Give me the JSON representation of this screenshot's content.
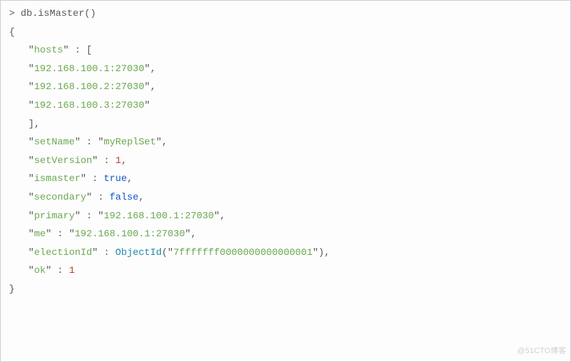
{
  "prompt_symbol": ">",
  "command": "db.isMaster()",
  "result": {
    "hosts": [
      "192.168.100.1:27030",
      "192.168.100.2:27030",
      "192.168.100.3:27030"
    ],
    "setName": "myReplSet",
    "setVersion": 1,
    "ismaster": true,
    "secondary": false,
    "primary": "192.168.100.1:27030",
    "me": "192.168.100.1:27030",
    "electionId_func": "ObjectId",
    "electionId_arg": "7fffffff0000000000000001",
    "ok": 1
  },
  "punct": {
    "open_brace": "{",
    "close_brace": "}",
    "open_bracket": "[",
    "close_bracket": "],",
    "colon_space": " : ",
    "comma": ",",
    "quote": "\"",
    "paren_open": "(",
    "paren_close_comma": "),"
  },
  "keys": {
    "hosts": "hosts",
    "setName": "setName",
    "setVersion": "setVersion",
    "ismaster": "ismaster",
    "secondary": "secondary",
    "primary": "primary",
    "me": "me",
    "electionId": "electionId",
    "ok": "ok"
  },
  "watermark": "@51CTO博客"
}
